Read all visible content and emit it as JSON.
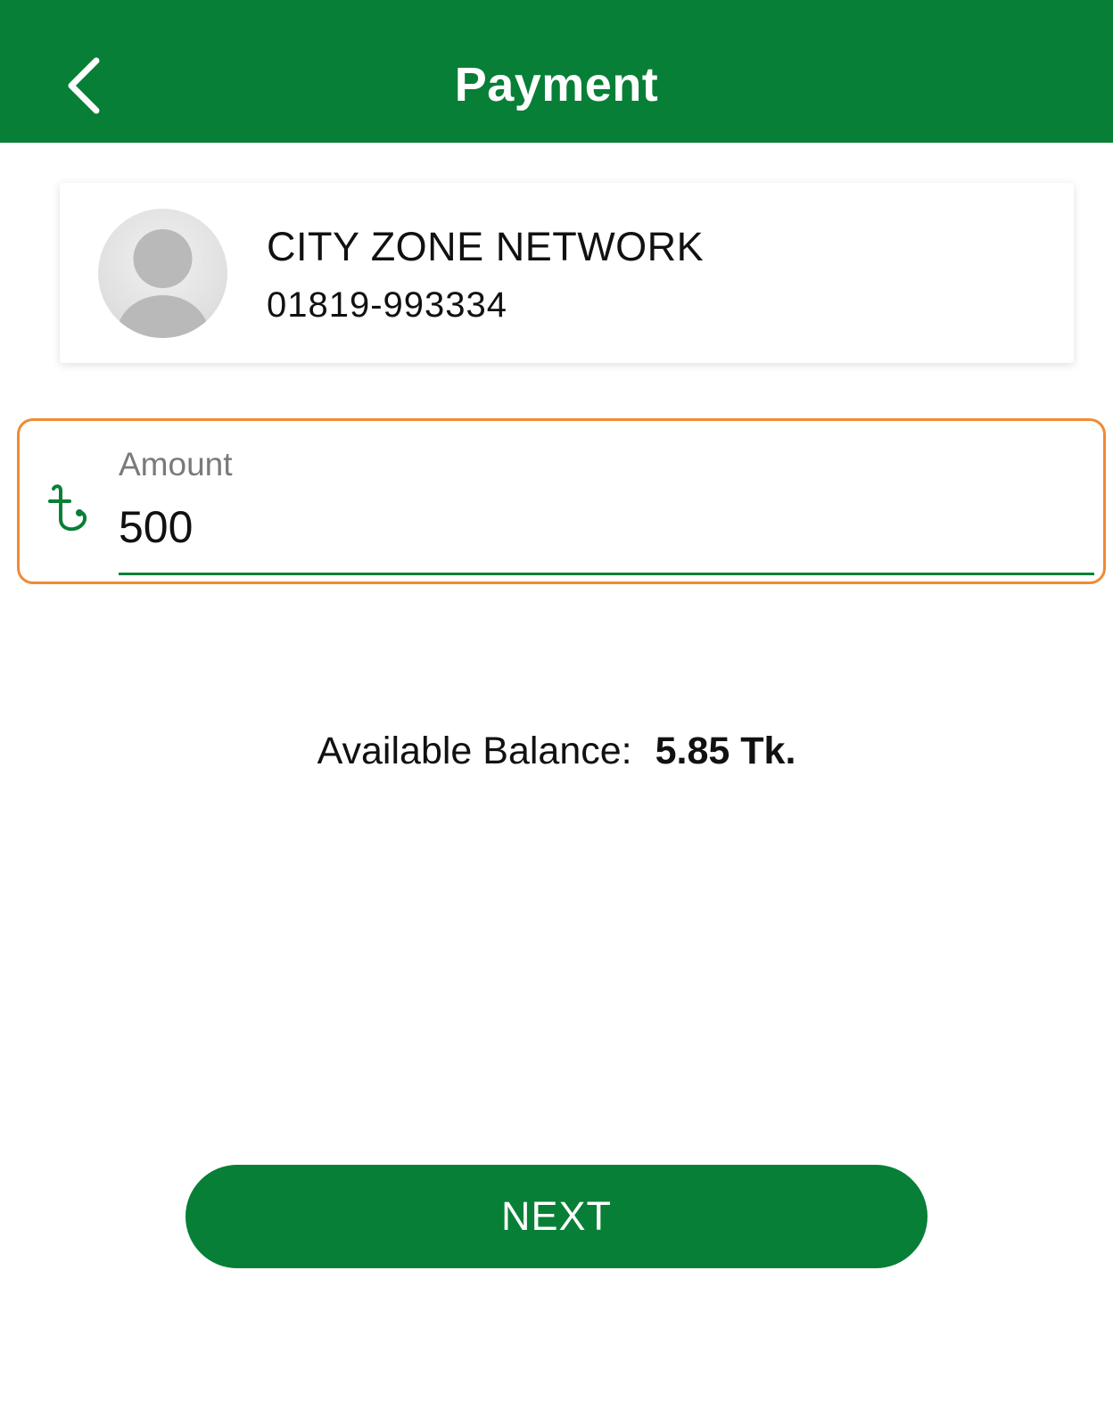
{
  "header": {
    "title": "Payment",
    "back_icon": "chevron-left-icon"
  },
  "recipient": {
    "avatar_icon": "user-avatar-icon",
    "name": "CITY ZONE NETWORK",
    "phone": "01819-993334"
  },
  "amount": {
    "currency_icon": "taka-icon",
    "label": "Amount",
    "value": "500"
  },
  "balance": {
    "label": "Available Balance:",
    "value": "5.85 Tk."
  },
  "next_button": {
    "label": "NEXT"
  },
  "colors": {
    "primary_green": "#077f36",
    "focus_orange": "#f08a32",
    "label_gray": "#7a7a7a"
  }
}
